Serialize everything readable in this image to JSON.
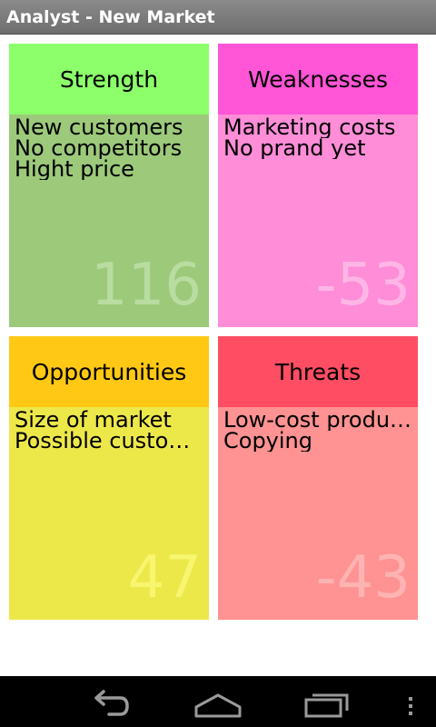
{
  "app": {
    "title": "Analyst - New Market"
  },
  "quadrants": [
    {
      "title": "Strength",
      "items": [
        "New customers",
        "No competitors",
        "Hight price"
      ],
      "score": "116",
      "header_color": "#8cff6b",
      "body_color": "#9cc97a",
      "score_color": "#b9dca0"
    },
    {
      "title": "Weaknesses",
      "items": [
        "Marketing costs",
        "No prand yet"
      ],
      "score": "-53",
      "header_color": "#ff55d6",
      "body_color": "#ff8dd8",
      "score_color": "#ffb6e6"
    },
    {
      "title": "Opportunities",
      "items": [
        "Size of market",
        "Possible customers"
      ],
      "score": "47",
      "header_color": "#ffc814",
      "body_color": "#ede84a",
      "score_color": "#f8f56e"
    },
    {
      "title": "Threats",
      "items": [
        "Low-cost producers",
        "Copying"
      ],
      "score": "-43",
      "header_color": "#ff4d63",
      "body_color": "#ff9292",
      "score_color": "#ffb3b3"
    }
  ],
  "navigation": {
    "back_icon": "back-arrow-icon",
    "home_icon": "home-icon",
    "recent_icon": "recent-apps-icon",
    "menu_icon": "overflow-menu-icon"
  }
}
